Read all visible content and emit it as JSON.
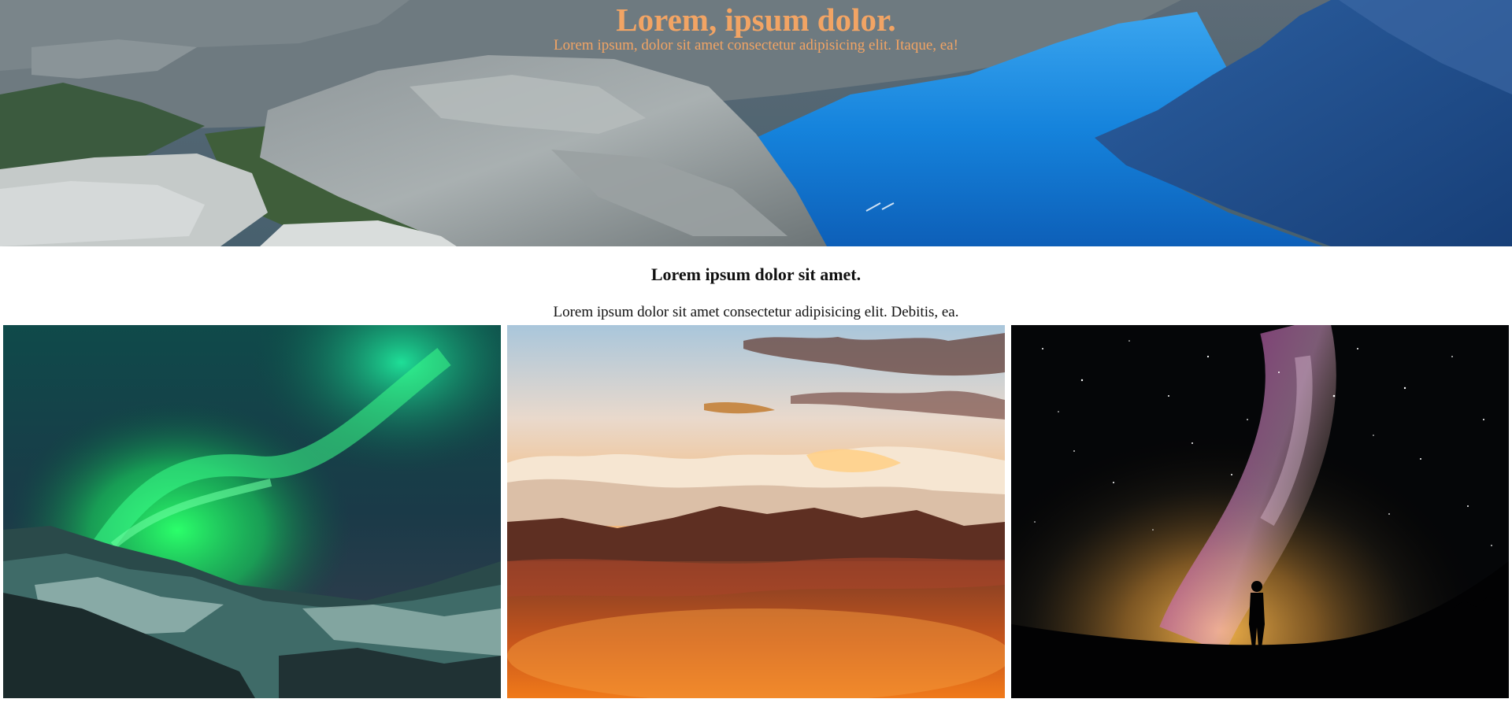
{
  "hero": {
    "title": "Lorem, ipsum dolor.",
    "subtitle": "Lorem ipsum, dolor sit amet consectetur adipisicing elit. Itaque, ea!",
    "image": "fjord-landscape-image",
    "title_color": "#f2a464"
  },
  "section": {
    "heading": "Lorem ipsum dolor sit amet.",
    "text": "Lorem ipsum dolor sit amet consectetur adipisicing elit. Debitis, ea."
  },
  "gallery": {
    "items": [
      {
        "image": "aurora-borealis-image"
      },
      {
        "image": "sunset-mountains-image"
      },
      {
        "image": "milky-way-silhouette-image"
      }
    ]
  }
}
